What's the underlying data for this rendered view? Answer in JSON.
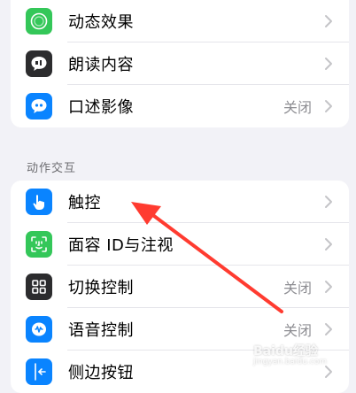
{
  "accessibility": {
    "group_top": [
      {
        "label": "动态效果",
        "value": "",
        "icon": "motion-icon",
        "color": "#34c759"
      },
      {
        "label": "朗读内容",
        "value": "",
        "icon": "speech-bubble-icon",
        "color": "#2c2c2e"
      },
      {
        "label": "口述影像",
        "value": "关闭",
        "icon": "quote-bubble-icon",
        "color": "#0a84ff"
      }
    ],
    "section_interaction": "动作交互",
    "group_interaction": [
      {
        "label": "触控",
        "value": "",
        "icon": "hand-touch-icon",
        "color": "#0a84ff"
      },
      {
        "label": "面容 ID与注视",
        "value": "",
        "icon": "face-id-icon",
        "color": "#34c759"
      },
      {
        "label": "切换控制",
        "value": "关闭",
        "icon": "switch-control-icon",
        "color": "#2c2c2e"
      },
      {
        "label": "语音控制",
        "value": "关闭",
        "icon": "voice-control-icon",
        "color": "#0a84ff"
      },
      {
        "label": "侧边按钮",
        "value": "",
        "icon": "side-button-icon",
        "color": "#0a84ff"
      }
    ]
  },
  "annotation": {
    "color": "#ff3b30"
  },
  "watermark": {
    "text": "Baidu经验",
    "sub": "jingyan.baidu.com"
  }
}
